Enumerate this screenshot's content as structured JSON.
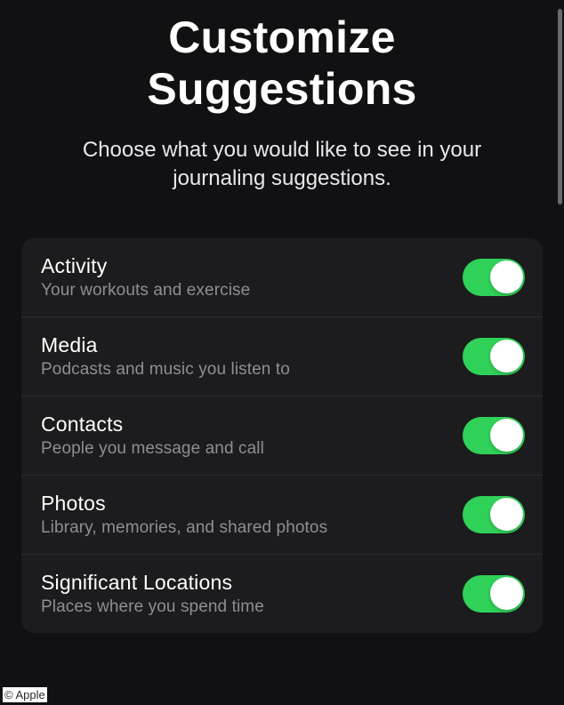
{
  "title_line1": "Customize",
  "title_line2": "Suggestions",
  "subtitle": "Choose what you would like to see in your journaling suggestions.",
  "settings": [
    {
      "title": "Activity",
      "desc": "Your workouts and exercise",
      "on": true
    },
    {
      "title": "Media",
      "desc": "Podcasts and music you listen to",
      "on": true
    },
    {
      "title": "Contacts",
      "desc": "People you message and call",
      "on": true
    },
    {
      "title": "Photos",
      "desc": "Library, memories, and shared photos",
      "on": true
    },
    {
      "title": "Significant Locations",
      "desc": "Places where you spend time",
      "on": true
    }
  ],
  "colors": {
    "toggle_on": "#30d158",
    "background": "#111113",
    "card": "#1c1c1e"
  },
  "attribution": "© Apple"
}
